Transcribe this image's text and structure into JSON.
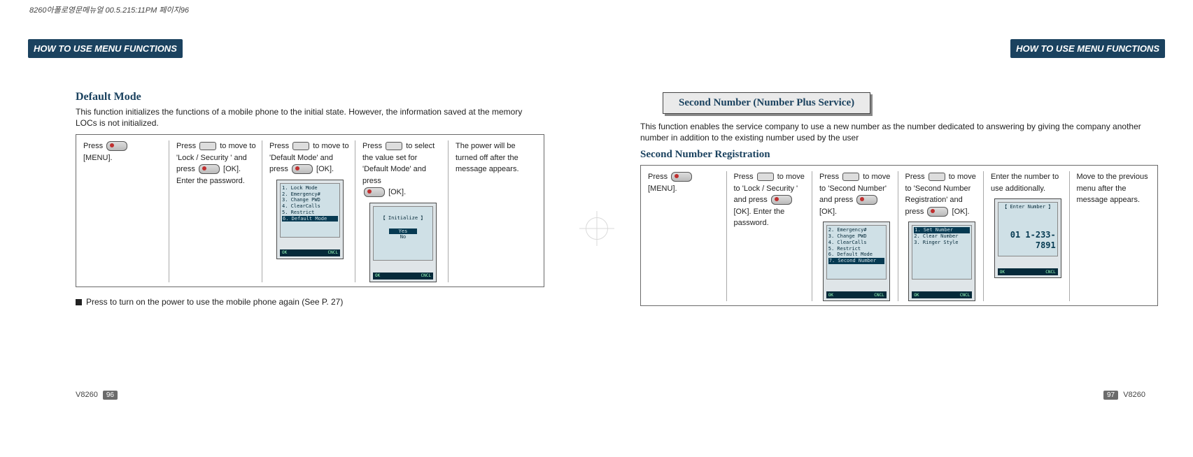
{
  "header_stamp": "8260아폴로영문메뉴얼 00.5.215:11PM 페이지96",
  "tab_text": "HOW TO USE MENU FUNCTIONS",
  "left": {
    "title": "Default Mode",
    "desc": "This function initializes the  functions of a  mobile phone to the  initial state. However, the information saved at the memory LOCs is not initialized.",
    "steps": [
      {
        "pre": "Press ",
        "post": " [MENU]."
      },
      {
        "line1": "Press ",
        "line1_post": " to move to  'Lock / Security ' and press ",
        "line1_end": " [OK].  Enter the  password."
      },
      {
        "line1": "Press ",
        "line1_post": " to move to  'Default Mode'  and press ",
        "line1_end": " [OK]."
      },
      {
        "line1": "Press ",
        "line1_post": " to select the value set for  'Default Mode' and press ",
        "line1_end": " [OK]."
      },
      {
        "text": "The power will be turned off after the message appears."
      }
    ],
    "screen_menu": [
      "1. Lock Mode",
      "2. Emergency#",
      "3. Change PWD",
      "4. ClearCalls",
      "5. Restrict",
      "6. Default Mode"
    ],
    "screen_init": {
      "title": "【 Initialize 】",
      "yes": "Yes",
      "no": "No"
    },
    "screen_bar_ok": "OK",
    "screen_bar_cncl": "CNCL",
    "note": "Press to turn on the power to use the mobile phone again (See P. 27)",
    "footer_model": "V8260",
    "footer_page": "96"
  },
  "right": {
    "ribbon": "Second Number (Number Plus Service)",
    "desc": "This function  enables the   service company to  use  a new  number  as the  number dedicated to answering by  giving  the company  another number   in addition to  the existing number used by the user",
    "subtitle": "Second Number Registration",
    "steps": [
      {
        "pre": "Press ",
        "post": " [MENU]."
      },
      {
        "pre": "Press ",
        "mid": " to move to  'Lock / Security ' and  press ",
        "post": " [OK].  Enter the password."
      },
      {
        "pre": "Press ",
        "mid": " to move to  'Second Number'  and press ",
        "post": " [OK]."
      },
      {
        "pre": "Press ",
        "mid": " to move to  'Second Number Registration' and press ",
        "post": " [OK]."
      },
      {
        "text": "Enter the number to use additionally."
      },
      {
        "text": "Move to the previous menu after the message appears."
      }
    ],
    "screen_menu2": [
      "2. Emergency#",
      "3. Change PWD",
      "4. ClearCalls",
      "5. Restrict",
      "6. Default Mode",
      "7. Second Number"
    ],
    "screen_sn": [
      "1. Set Number",
      "2. Clear Number",
      "3. Ringer Style"
    ],
    "screen_enter": {
      "title": "【 Enter Number 】",
      "num": "01\n1-233-7891"
    },
    "footer_model": "V8260",
    "footer_page": "97"
  }
}
